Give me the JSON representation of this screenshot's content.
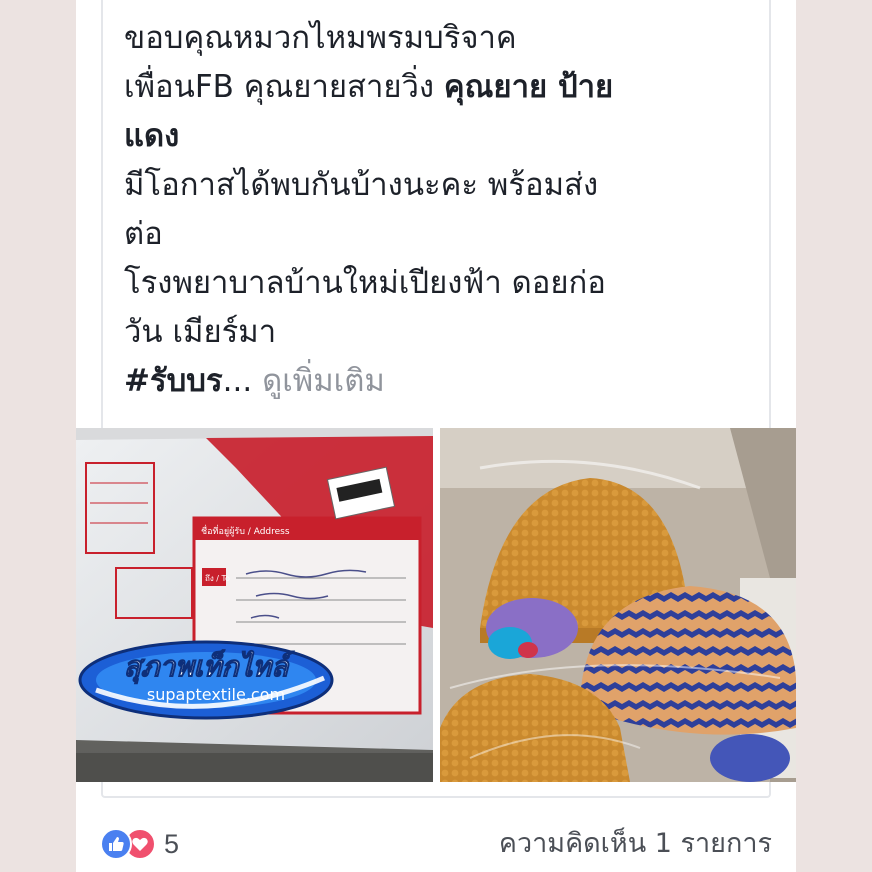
{
  "post": {
    "lines": [
      {
        "segments": [
          {
            "text": "ขอบคุณหมวกไหมพรมบริจาค",
            "bold": false
          }
        ]
      },
      {
        "segments": [
          {
            "text": "เพื่อนFB คุณยายสายวิ่ง ",
            "bold": false
          },
          {
            "text": "คุณยาย ป้าย",
            "bold": true
          }
        ]
      },
      {
        "segments": [
          {
            "text": "แดง",
            "bold": true
          }
        ]
      },
      {
        "segments": [
          {
            "text": "มีโอกาสได้พบกันบ้างนะคะ พร้อมส่ง",
            "bold": false
          }
        ]
      },
      {
        "segments": [
          {
            "text": "ต่อ",
            "bold": false
          }
        ]
      },
      {
        "segments": [
          {
            "text": "โรงพยาบาลบ้านใหม่เปียงฟ้า ดอยก่อ",
            "bold": false
          }
        ]
      },
      {
        "segments": [
          {
            "text": "วัน เมียร์มา",
            "bold": false
          }
        ]
      }
    ],
    "hashtag": "#รับบร",
    "ellipsis": "...",
    "see_more": "ดูเพิ่มเติม"
  },
  "photos": {
    "left": {
      "address_label": "ชื่อที่อยู่ผู้รับ / Address",
      "to_label": "ถึง / To",
      "watermark_thai": "สุภาพเท็กไทล์",
      "watermark_url": "supaptextile.com"
    }
  },
  "footer": {
    "reaction_count": "5",
    "comments": "ความคิดเห็น 1 รายการ"
  },
  "colors": {
    "text": "#1d2129",
    "muted": "#90949c",
    "like": "#4a80f0",
    "love": "#f0506e",
    "parcel_red": "#c8202c"
  }
}
